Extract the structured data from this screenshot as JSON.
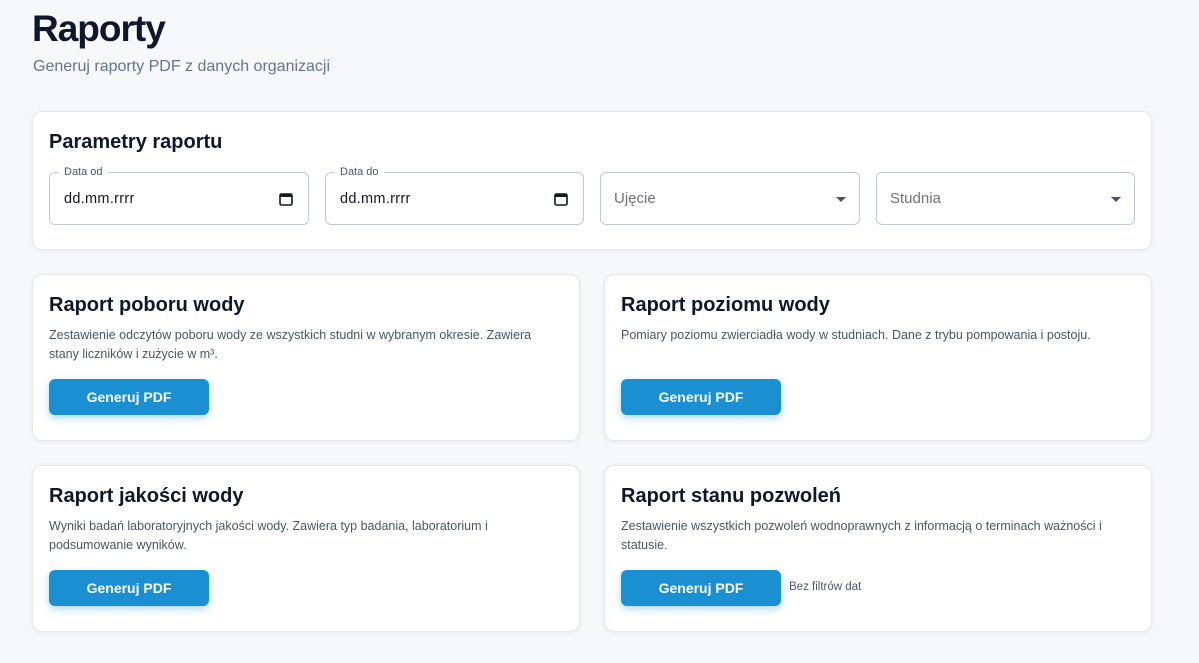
{
  "header": {
    "title": "Raporty",
    "subtitle": "Generuj raporty PDF z danych organizacji"
  },
  "parameters": {
    "title": "Parametry raportu",
    "date_from": {
      "label": "Data od",
      "value": "dd.mm.rrrr",
      "icon": "calendar-icon"
    },
    "date_to": {
      "label": "Data do",
      "value": "dd.mm.rrrr",
      "icon": "calendar-icon"
    },
    "intake_select": {
      "placeholder": "Ujęcie",
      "icon": "caret-down-icon"
    },
    "well_select": {
      "placeholder": "Studnia",
      "icon": "caret-down-icon"
    }
  },
  "reports": {
    "water_intake": {
      "title": "Raport poboru wody",
      "description": "Zestawienie odczytów poboru wody ze wszystkich studni w wybranym okresie. Zawiera stany liczników i zużycie w m³.",
      "button": "Generuj PDF"
    },
    "water_level": {
      "title": "Raport poziomu wody",
      "description": "Pomiary poziomu zwierciadła wody w studniach. Dane z trybu pompowania i postoju.",
      "button": "Generuj PDF"
    },
    "water_quality": {
      "title": "Raport jakości wody",
      "description": "Wyniki badań laboratoryjnych jakości wody. Zawiera typ badania, laboratorium i podsumowanie wyników.",
      "button": "Generuj PDF"
    },
    "permits": {
      "title": "Raport stanu pozwoleń",
      "description": "Zestawienie wszystkich pozwoleń wodnoprawnych z informacją o terminach ważności i statusie.",
      "button": "Generuj PDF",
      "note": "Bez filtrów dat"
    }
  },
  "colors": {
    "accent": "#1a8fd1",
    "background": "#f7f8f9",
    "card": "#ffffff",
    "heading": "#0f172a",
    "muted": "#64748b"
  }
}
